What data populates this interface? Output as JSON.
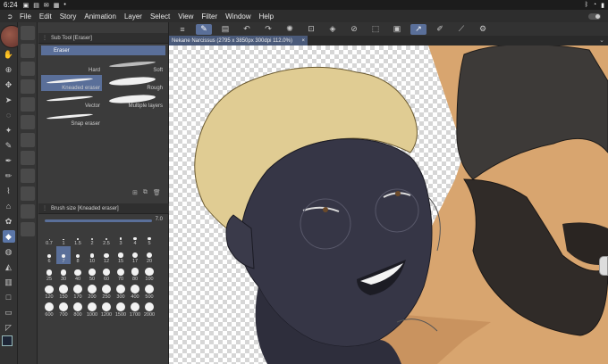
{
  "status": {
    "time": "6:24",
    "icons": [
      "notification-icon",
      "gallery-icon",
      "mail-icon",
      "calendar-icon",
      "dot-icon"
    ],
    "right_icons": [
      "bluetooth-icon",
      "wifi-icon",
      "battery-icon"
    ]
  },
  "menu": {
    "items": [
      "File",
      "Edit",
      "Story",
      "Animation",
      "Layer",
      "Select",
      "View",
      "Filter",
      "Window",
      "Help"
    ]
  },
  "subtool": {
    "title": "Sub Tool [Eraser]",
    "active_tab": "Eraser",
    "brushes": [
      {
        "label": "Hard"
      },
      {
        "label": "Soft"
      },
      {
        "label": "Kneaded eraser"
      },
      {
        "label": "Rough"
      },
      {
        "label": "Vector"
      },
      {
        "label": "Multiple layers"
      },
      {
        "label": "Snap eraser"
      }
    ]
  },
  "brush_size": {
    "title": "Brush size [Kneaded eraser]",
    "value": "7.0",
    "presets": [
      "0.7",
      "1",
      "1.5",
      "2",
      "2.5",
      "3",
      "4",
      "5",
      "6",
      "7",
      "8",
      "10",
      "12",
      "15",
      "17",
      "20",
      "25",
      "30",
      "40",
      "50",
      "60",
      "70",
      "80",
      "100",
      "120",
      "150",
      "170",
      "200",
      "250",
      "300",
      "400",
      "500",
      "600",
      "700",
      "800",
      "1000",
      "1200",
      "1500",
      "1700",
      "2000"
    ],
    "selected": "7"
  },
  "document": {
    "tab_label": "Nekane Narcissus (2795 x 3850px 300dpi 112.0%)"
  },
  "colors": {
    "accent": "#5a6f99",
    "panel": "#3b3b3b",
    "menubar": "#2d2d2d"
  }
}
